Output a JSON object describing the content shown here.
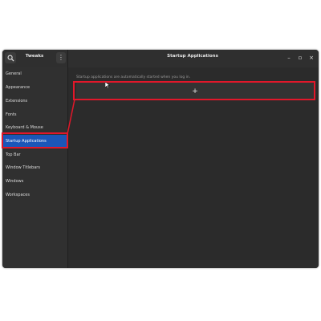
{
  "app": {
    "title": "Tweaks",
    "menu_label": "⋮",
    "search_icon": "search-icon"
  },
  "window": {
    "title": "Startup Applications",
    "minimize_label": "–",
    "maximize_label": "▫",
    "close_label": "×"
  },
  "sidebar": {
    "items": [
      {
        "label": "General"
      },
      {
        "label": "Appearance"
      },
      {
        "label": "Extensions"
      },
      {
        "label": "Fonts"
      },
      {
        "label": "Keyboard & Mouse"
      },
      {
        "label": "Startup Applications",
        "active": true
      },
      {
        "label": "Top Bar"
      },
      {
        "label": "Window Titlebars"
      },
      {
        "label": "Windows"
      },
      {
        "label": "Workspaces"
      }
    ]
  },
  "main": {
    "hint": "Startup applications are automatically started when you log in.",
    "add_label": "+"
  },
  "colors": {
    "active_item": "#1b56b8",
    "highlight": "#e2172a",
    "window_bg": "#2b2b2b"
  }
}
